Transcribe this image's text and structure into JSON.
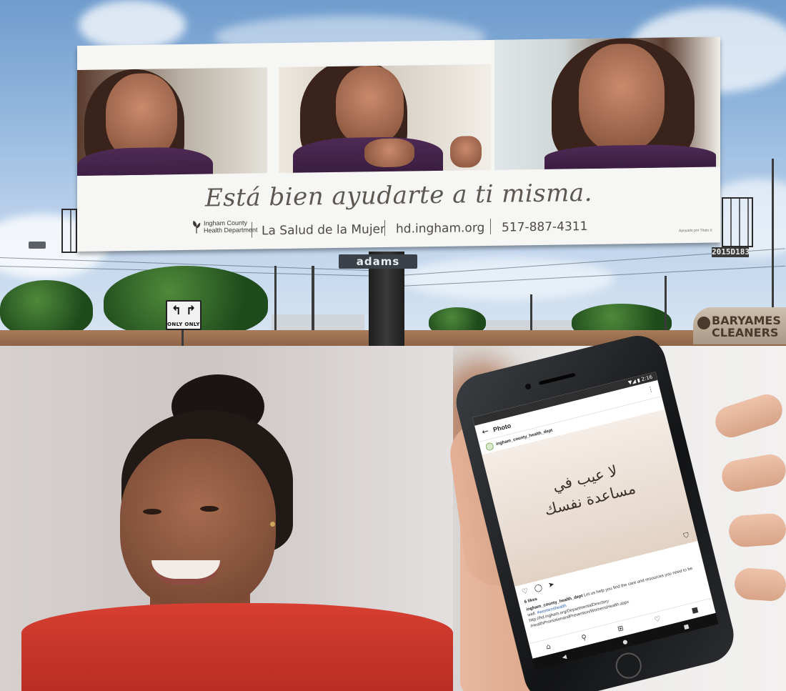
{
  "billboard": {
    "tagline": "Está bien ayudarte a ti misma.",
    "logo_line1": "Ingham County",
    "logo_line2": "Health Department",
    "program": "La Salud de la Mujer",
    "website": "hd.ingham.org",
    "phone": "517-887-4311",
    "sponsor": "Apoyado por Título X",
    "post_brand": "adams",
    "serial": "2015D183"
  },
  "street": {
    "lane_sign_arrows": "↰ ↱",
    "lane_sign_text": "ONLY ONLY",
    "store_line1": "BARYAMES",
    "store_line2": "CLEANERS"
  },
  "phone": {
    "status": "▼◢ ▮ 2:16",
    "header_title": "Photo",
    "back_icon": "←",
    "more_icon": "⋮",
    "username": "ingham_county_health_dept",
    "post_text_line1": "لا عيب في",
    "post_text_line2": "مساعدة نفسك",
    "likes": "6 likes",
    "caption_user": "ingham_county_health_dept",
    "caption_body": " Let us help you find the care and resources you need to be well. ",
    "caption_tag": "#womenshealth",
    "caption_link_1": "http://hd.ingham.org/DepartmentalDirectory",
    "caption_link_2": "/HealthPromotionandPrevention/WomensHealth.aspx",
    "actions": [
      "♡",
      "◯",
      "➤"
    ],
    "bookmark_icon": "⛉",
    "nav_icons": [
      "⌂",
      "⚲",
      "⊞",
      "♡",
      "■"
    ],
    "android_nav": [
      "◀",
      "●",
      "■"
    ]
  },
  "colors": {
    "billboard_bg": "#f6f6f4",
    "tagline_text": "#5d5752",
    "shirt_red": "#d73f32",
    "link_blue": "#2a5db0"
  }
}
